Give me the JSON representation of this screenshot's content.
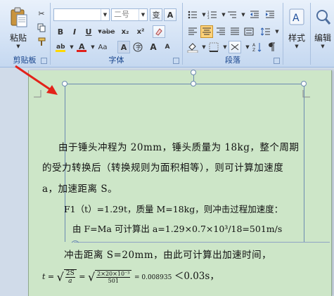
{
  "ribbon": {
    "clipboard": {
      "label": "剪贴板",
      "paste_label": "粘贴"
    },
    "font": {
      "label": "字体",
      "font_name": "",
      "font_size": "二号",
      "phonetic_label": "变",
      "format_buttons": [
        "B",
        "I",
        "U",
        "abe",
        "x₂",
        "x²"
      ],
      "row2": [
        "Aa",
        "A",
        "A",
        "A"
      ]
    },
    "paragraph": {
      "label": "段落"
    },
    "styles": {
      "label": "样式"
    },
    "editing": {
      "label": "编辑"
    }
  },
  "document": {
    "para1_line1": "由于锤头冲程为 20mm，锤头质量为 18kg，整个周期",
    "para1_line2": "的受力转换后（转换规则为面积相等），则可计算加速度",
    "para1_line3": "a，加速距离 S。",
    "line4": "F1（t）=1.29t，质量 M=18kg，则冲击过程加速度：",
    "line5": "由 F=Ma   可计算出 a=1.29×0.7×10³/18=501m/s",
    "line6": "冲击距离  S=20mm，由此可计算出加速时间，",
    "formula": {
      "lhs": "t =",
      "num1": "2S",
      "den1": "a",
      "eq": "=",
      "num2": "2×20×10⁻³",
      "den2": "501",
      "result": "= 0.008935",
      "compare": "＜0.03s，"
    }
  },
  "colors": {
    "ribbon_label": "#15428b",
    "page_bg": "#cde6c8",
    "arrow": "#e32219",
    "font_color": "#e0201b",
    "highlight": "#ffd800"
  }
}
